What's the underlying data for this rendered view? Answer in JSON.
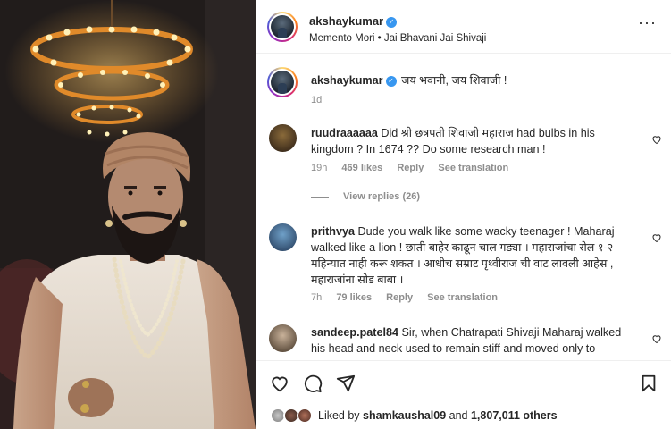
{
  "post": {
    "username": "akshaykumar",
    "audio": "Memento Mori • Jai Bhavani Jai Shivaji",
    "caption": "जय भवानी, जय शिवाजी !",
    "caption_age": "1d"
  },
  "comments": [
    {
      "username": "ruudraaaaaa",
      "text": "Did श्री छत्रपती शिवाजी महाराज had bulbs in his kingdom ? In 1674 ?? Do some research man !",
      "age": "19h",
      "likes": "469 likes",
      "reply": "Reply",
      "translate": "See translation",
      "view_replies": "View replies (26)"
    },
    {
      "username": "prithvya",
      "text": "Dude you walk like some wacky teenager ! Maharaj walked like a lion ! छाती बाहेर काढून चाल गड्या । महाराजांचा रोल १-२ महिन्यात नाही करू शकत । आधीच सम्राट पृथ्वीराज ची वाट लावली आहेस , महाराजांना सोड बाबा ।",
      "age": "7h",
      "likes": "79 likes",
      "reply": "Reply",
      "translate": "See translation"
    },
    {
      "username": "sandeep.patel84",
      "text": "Sir, when Chatrapati Shivaji Maharaj walked his head and neck used to remain stiff and moved only to"
    }
  ],
  "footer": {
    "liked_by_prefix": "Liked by",
    "liked_by_user": "shamkaushal09",
    "liked_by_and": "and",
    "liked_by_others": "1,807,011 others"
  },
  "icons": [
    "more-options-icon",
    "verified-badge-icon",
    "heart-icon",
    "comment-icon",
    "share-icon",
    "save-icon"
  ],
  "colors": {
    "verified": "#3897f0",
    "muted": "#8e8e8e",
    "text": "#262626"
  }
}
